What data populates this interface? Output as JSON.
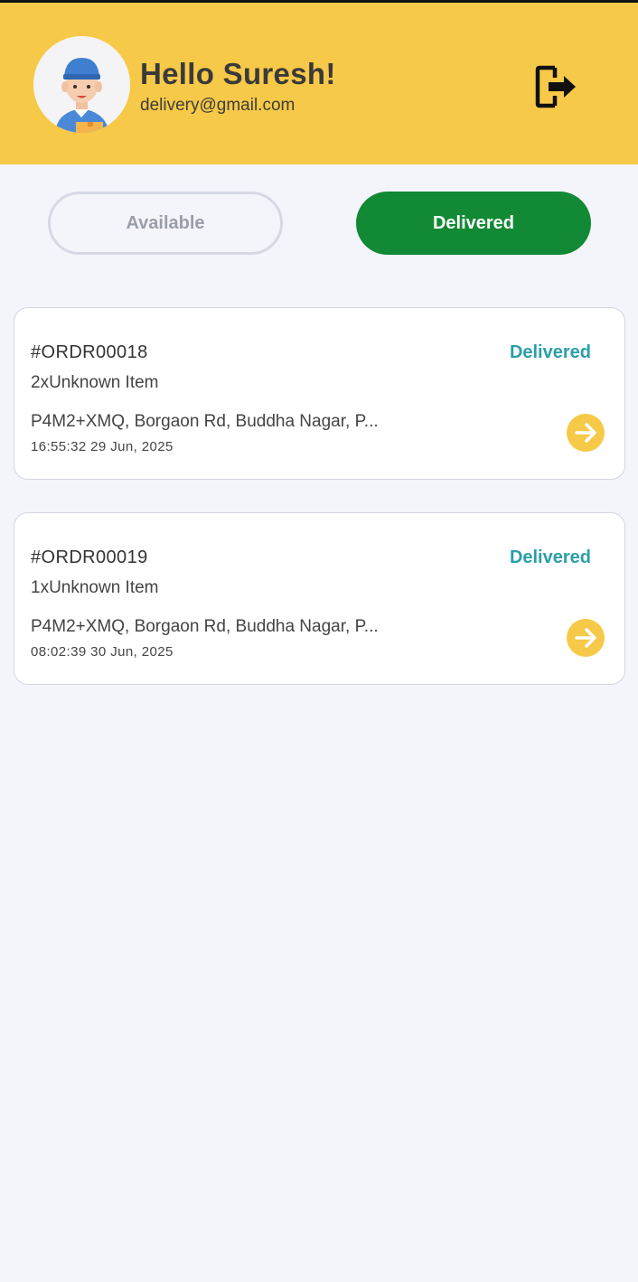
{
  "header": {
    "greeting": "Hello Suresh!",
    "email": "delivery@gmail.com",
    "avatar_icon": "delivery-person-avatar",
    "logout_icon": "logout-icon"
  },
  "tabs": [
    {
      "label": "Available",
      "active": false
    },
    {
      "label": "Delivered",
      "active": true
    }
  ],
  "orders": [
    {
      "id": "#ORDR00018",
      "status": "Delivered",
      "items": "2xUnknown Item",
      "address": "P4M2+XMQ, Borgaon Rd, Buddha Nagar, P...",
      "time": "16:55:32 29 Jun, 2025"
    },
    {
      "id": "#ORDR00019",
      "status": "Delivered",
      "items": "1xUnknown Item",
      "address": "P4M2+XMQ, Borgaon Rd, Buddha Nagar, P...",
      "time": "08:02:39 30 Jun, 2025"
    }
  ],
  "colors": {
    "header_bg": "#f7c948",
    "active_tab": "#128934",
    "status_text": "#2b9faa",
    "arrow_button": "#f7c948",
    "page_bg": "#f3f5fa"
  }
}
